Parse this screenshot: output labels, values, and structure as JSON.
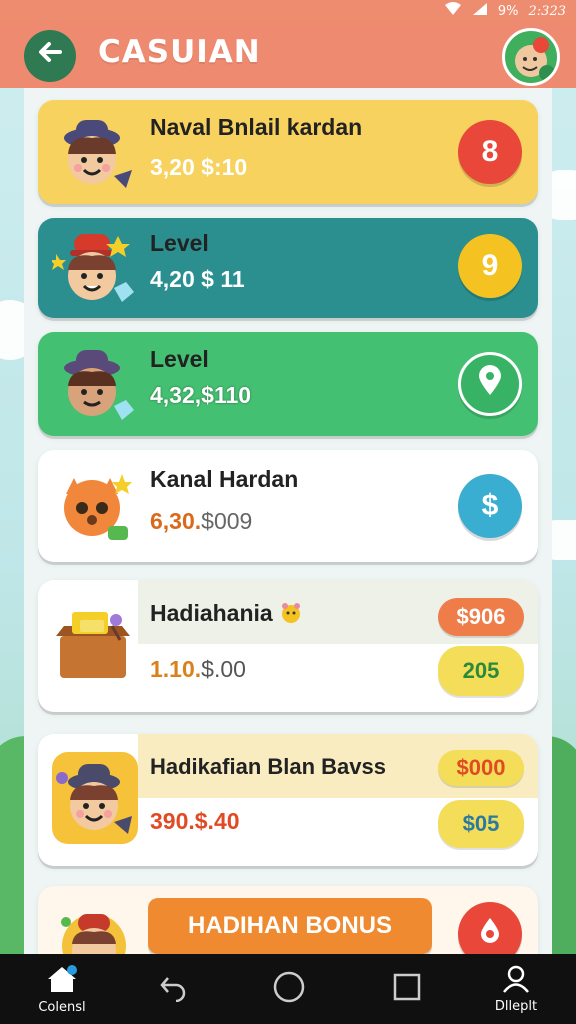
{
  "status_bar": {
    "battery": "9%",
    "time": "2:323"
  },
  "header": {
    "title": "CASUIAN",
    "back_icon": "arrow-left-icon",
    "profile_icon": "profile-avatar-icon",
    "colors": {
      "bar": "#ee8a6f",
      "back": "#2f7a52"
    }
  },
  "cards": [
    {
      "title": "Naval Bnlail kardan",
      "amount": "3,20 $:10",
      "button_symbol": "8",
      "button_color": "#e8473a",
      "card_color": "#f7d25e",
      "amount_color": "#ffffff"
    },
    {
      "title": "Level",
      "amount": "4,20 $ 11",
      "button_symbol": "9",
      "button_color": "#f4c321",
      "card_color": "#2b8f90",
      "amount_color": "#ffffff"
    },
    {
      "title": "Level",
      "amount": "4,32,$110",
      "button_icon": "location-pin-icon",
      "button_color": "#38b264",
      "card_color": "#43c071",
      "amount_color": "#ffffff"
    },
    {
      "title": "Kanal Hardan",
      "amount_part1": "6,30.",
      "amount_part2": "$009",
      "button_symbol": "$",
      "button_color": "#3aaed0",
      "card_color": "#ffffff"
    },
    {
      "title": "Hadiahania",
      "amount_part1": "1.10.",
      "amount_part2": "$.00",
      "pill_top": "$906",
      "pill_bottom": "205",
      "pill_top_color": "#ef7d4a",
      "pill_bottom_color": "#f4dd58"
    },
    {
      "title": "Hadikafian Blan Bavss",
      "amount": "390.$.40",
      "pill_top": "$000",
      "pill_bottom": "$05",
      "pill_top_color": "#f4dd58",
      "pill_bottom_color": "#f4dd58"
    },
    {
      "button_label": "HADIHAN BONUS",
      "button_color": "#f08a30",
      "side_button_color": "#e8473a"
    }
  ],
  "nav": {
    "items": [
      {
        "label": "Colensl",
        "icon": "home-icon"
      },
      {
        "label": "",
        "icon": "back-icon"
      },
      {
        "label": "",
        "icon": "home-circle-icon"
      },
      {
        "label": "",
        "icon": "recents-square-icon"
      },
      {
        "label": "Dlleplt",
        "icon": "person-icon"
      }
    ]
  }
}
